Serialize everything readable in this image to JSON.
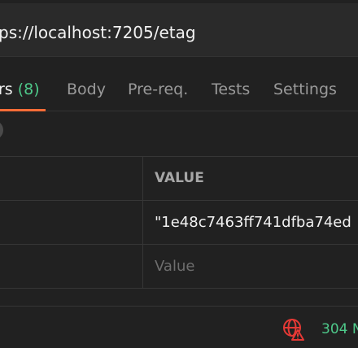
{
  "url": {
    "value": "ps://localhost:7205/etag"
  },
  "tabs": [
    {
      "label": "rs",
      "count": "(8)",
      "active": true
    },
    {
      "label": "Body"
    },
    {
      "label": "Pre-req."
    },
    {
      "label": "Tests"
    },
    {
      "label": "Settings"
    }
  ],
  "headers_table": {
    "column_value": "VALUE",
    "rows": [
      {
        "value": "\"1e48c7463ff741dfba74ed"
      }
    ],
    "new_row_placeholder": "Value"
  },
  "status": {
    "code_text": "304 N",
    "icon": "globe-warning-icon",
    "color": "#4ec98a"
  },
  "colors": {
    "accent": "#ff6c37",
    "count": "#4ec98a"
  }
}
